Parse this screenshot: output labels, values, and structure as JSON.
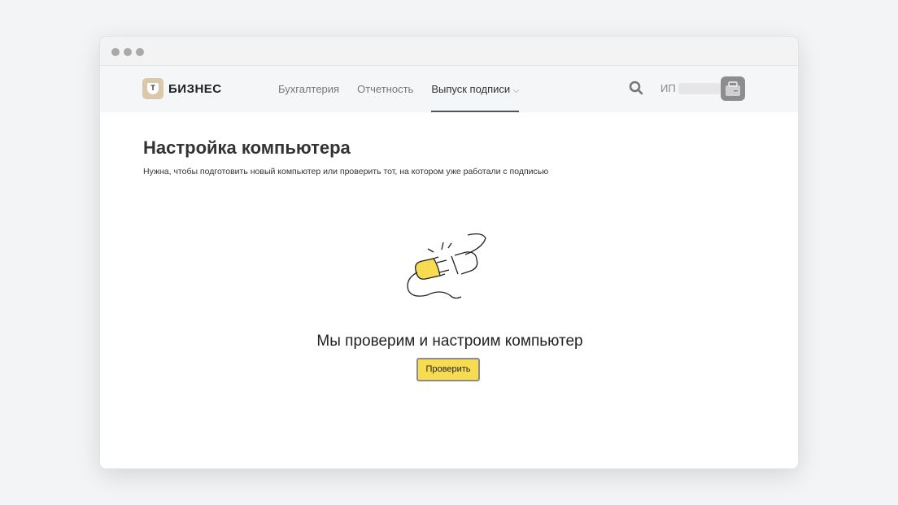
{
  "logo": {
    "mark": "Т",
    "text": "БИЗНЕС"
  },
  "nav": [
    {
      "label": "Бухгалтерия"
    },
    {
      "label": "Отчетность"
    },
    {
      "label": "Выпуск подписи"
    }
  ],
  "user": {
    "prefix": "ИП"
  },
  "page": {
    "title": "Настройка компьютера",
    "subtitle": "Нужна, чтобы подготовить новый компьютер или проверить тот, на котором уже работали с подписью",
    "caption": "Мы проверим и настроим компьютер",
    "button": "Проверить"
  },
  "colors": {
    "accent": "#f7dc52"
  }
}
